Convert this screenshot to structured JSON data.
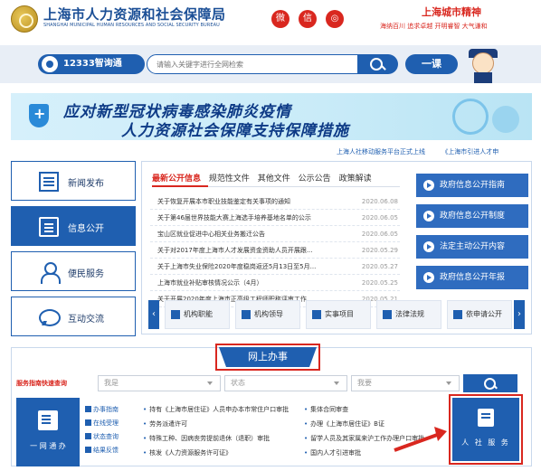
{
  "header": {
    "title": "上海市人力资源和社会保障局",
    "subtitle": "SHANGHAI MUNICIPAL HUMAN RESOURCES AND SOCIAL SECURITY BUREAU",
    "social_weibo": "微",
    "social_wechat": "信",
    "social_other": "◎",
    "spirit_title": "上海城市精神",
    "spirit_line": "海纳百川  追求卓越  开明睿智  大气谦和"
  },
  "search": {
    "hotline_label": "12333智询通",
    "placeholder": "请输入关键字进行全网检索",
    "yike_label": "一课"
  },
  "banner": {
    "line1": "应对新型冠状病毒感染肺炎疫情",
    "line2": "人力资源社会保障支持保障措施"
  },
  "ticker": {
    "item1": "上海人社移动服务平台正式上线",
    "item2": "《上海市引进人才申"
  },
  "leftnav": {
    "news": "新闻发布",
    "info": "信息公开",
    "service": "便民服务",
    "interaction": "互动交流"
  },
  "tabs": [
    "最新公开信息",
    "规范性文件",
    "其他文件",
    "公示公告",
    "政策解读"
  ],
  "news": [
    {
      "title": "关于恢复开展本市职业技能鉴定有关事项的通知",
      "date": "2020.06.08"
    },
    {
      "title": "关于第46届世界技能大赛上海选手培养基地名单的公示",
      "date": "2020.06.05"
    },
    {
      "title": "宝山区就业促进中心相关业务搬迁公告",
      "date": "2020.06.05"
    },
    {
      "title": "关于对2017年度上海市人才发展资金资助人员开展跟...",
      "date": "2020.05.29"
    },
    {
      "title": "关于上海市失业保险2020年度稳岗返还5月13日至5月...",
      "date": "2020.05.27"
    },
    {
      "title": "上海市就业补贴审核情况公示（4月）",
      "date": "2020.05.25"
    },
    {
      "title": "关于开展2020年度上海市正高级工程师职称评审工作...",
      "date": "2020.05.21"
    }
  ],
  "right_buttons": [
    "政府信息公开指南",
    "政府信息公开制度",
    "法定主动公开内容",
    "政府信息公开年报"
  ],
  "quick_links": {
    "prev": "‹",
    "next": "›",
    "items": [
      "机构职能",
      "机构领导",
      "实事项目",
      "法律法规",
      "依申请公开"
    ]
  },
  "online": {
    "header": "网上办事",
    "guide_label": "服务指南快速查询",
    "select1": "我是",
    "select2": "状态",
    "select3": "我要",
    "yiwang_label": "一 网 通 办",
    "side": [
      "办事指南",
      "在线受理",
      "状态查询",
      "结果反馈"
    ],
    "col1": [
      "持有《上海市居住证》人员申办本市常住户口审批",
      "劳务派遣许可",
      "特殊工种、因病丧劳提前退休（退职）审批",
      "核发《人力资源服务许可证》"
    ],
    "col2": [
      "集体合同审查",
      "办理《上海市居住证》B证",
      "留学人员及其家属来沪工作办理户口审批",
      "国内人才引进审批"
    ],
    "renshe_label": "人 社 服 务"
  },
  "colors": {
    "brand_blue": "#1f5fb0",
    "accent_red": "#d9271f"
  }
}
